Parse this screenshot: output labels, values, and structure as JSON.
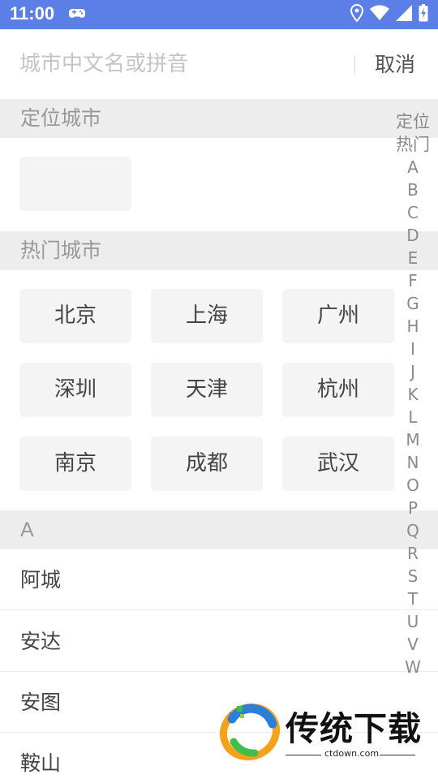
{
  "status_bar": {
    "time": "11:00",
    "left_icon": "gamepad-icon",
    "right_icons": [
      "location-icon",
      "wifi-icon",
      "signal-icon",
      "battery-icon"
    ]
  },
  "search": {
    "placeholder": "城市中文名或拼音",
    "value": "",
    "cancel_label": "取消"
  },
  "located_section": {
    "title": "定位城市",
    "city": ""
  },
  "hot_section": {
    "title": "热门城市",
    "cities": [
      "北京",
      "上海",
      "广州",
      "深圳",
      "天津",
      "杭州",
      "南京",
      "成都",
      "武汉"
    ]
  },
  "list_section": {
    "letter": "A",
    "cities": [
      "阿城",
      "安达",
      "安图",
      "鞍山"
    ]
  },
  "index_bar": {
    "items": [
      "定位",
      "热门",
      "A",
      "B",
      "C",
      "D",
      "E",
      "F",
      "G",
      "H",
      "I",
      "J",
      "K",
      "L",
      "M",
      "N",
      "O",
      "P",
      "Q",
      "R",
      "S",
      "T",
      "U",
      "V",
      "W"
    ]
  },
  "watermark": {
    "text": "传统下载",
    "url": "ctdown.com"
  },
  "colors": {
    "status_bar": "#5b7fe6",
    "section_header": "#ededed",
    "tag_bg": "#f4f4f4"
  }
}
